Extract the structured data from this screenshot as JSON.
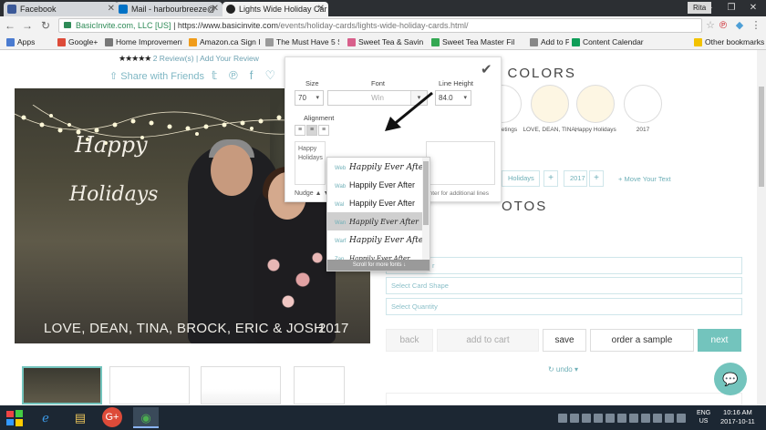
{
  "browser": {
    "tabs": [
      {
        "label": "Facebook",
        "color": "#3b5998"
      },
      {
        "label": "Mail - harbourbreeze@",
        "color": "#0072c6"
      },
      {
        "label": "Lights Wide Holiday Car",
        "color": "#222222"
      }
    ],
    "user": "Rita",
    "url_secure": "BasicInvite.com, LLC [US]",
    "url_host": "https://www.basicinvite.com",
    "url_path": "/events/holiday-cards/lights-wide-holiday-cards.html/",
    "bookmarks": [
      "Apps",
      "Google+",
      "Home Improvement",
      "Amazon.ca Sign In",
      "The Must Have 5 Ste",
      "Sweet Tea & Saving",
      "Sweet Tea Master Fil",
      "Add to PTE",
      "Content Calendar - G",
      "Other bookmarks"
    ]
  },
  "product": {
    "stars": "★★★★★",
    "reviews": "2 Review(s)",
    "separator": "|",
    "add_review": "Add Your Review",
    "share_label": "Share with Friends",
    "share_icons": {
      "twitter": "𝕥",
      "pinterest": "℗",
      "facebook": "f",
      "heart": "♡"
    }
  },
  "card": {
    "text_happy": "Happy",
    "text_holidays": "Holidays",
    "names": "LOVE, DEAN, TINA, BROCK, ERIC & JOSH",
    "year": "2017"
  },
  "editor": {
    "size_label": "Size",
    "size_value": "70",
    "font_label": "Font",
    "font_value": "Win",
    "line_height_label": "Line Height",
    "line_height_value": "84.0",
    "alignment_label": "Alignment",
    "text_value": "Happy Holidays",
    "nudge_label": "Nudge",
    "hint": "enter for additional lines",
    "font_options": [
      {
        "tag": "Web",
        "sample": "Happily Ever After"
      },
      {
        "tag": "Wab",
        "sample": "Happily Ever After"
      },
      {
        "tag": "Wal",
        "sample": "Happily Ever After"
      },
      {
        "tag": "Wan",
        "sample": "Happily Ever After"
      },
      {
        "tag": "Warf",
        "sample": "Happily Ever After"
      },
      {
        "tag": "Zan",
        "sample": "Happily Ever After"
      }
    ],
    "dropdown_footer": "Scroll for more fonts ↓"
  },
  "colors": {
    "title": "SELECT YOUR COLORS",
    "swatches": [
      {
        "color": "#ffffff",
        "label": ""
      },
      {
        "color": "#ffffff",
        "label": ""
      },
      {
        "color": "#ffffff",
        "label": "Greetings"
      },
      {
        "color": "#fdf6e3",
        "label": "LOVE, DEAN, TINA,"
      },
      {
        "color": "#fdf6e3",
        "label": "Happy Holidays"
      },
      {
        "color": "#ffffff",
        "label": "2017"
      }
    ]
  },
  "text_section": {
    "title": "T",
    "field_holidays": "Holidays",
    "field_year": "2017",
    "plus": "+",
    "move_text": "+ Move Your Text"
  },
  "photos": {
    "title": "OTOS"
  },
  "selects": {
    "first": "r",
    "card_shape": "Select Card Shape",
    "quantity": "Select Quantity"
  },
  "actions": {
    "back": "back",
    "add_to_cart": "add to cart",
    "save": "save",
    "order_sample": "order a sample",
    "next": "next",
    "undo": "↻ undo ▾"
  },
  "taskbar": {
    "lang_top": "ENG",
    "lang_bottom": "US",
    "time": "10:16 AM",
    "date": "2017-10-11"
  },
  "accent_color": "#73c4bd"
}
